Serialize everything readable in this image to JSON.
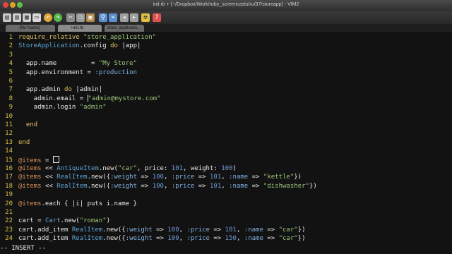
{
  "window": {
    "title": "init.rb + (~/Dropbox/Work/ruby_screencasts/ru/37/storeapp) - VIM2"
  },
  "toolbar": {
    "buttons": [
      "open-icon",
      "save-icon",
      "save-all-icon",
      "print-icon",
      "undo-icon",
      "redo-icon",
      "cut-icon",
      "copy-icon",
      "paste-icon",
      "find-icon",
      "find-next-icon",
      "back-icon",
      "forward-icon",
      "run-icon",
      "help-icon"
    ]
  },
  "tabs": [
    {
      "label": "-[No Name]",
      "active": false
    },
    {
      "label": "+init.rb",
      "active": true
    },
    {
      "label": "store_applicatio...",
      "active": false
    }
  ],
  "editor": {
    "lines": [
      {
        "num": "1",
        "tokens": [
          [
            "k",
            "require_relative"
          ],
          [
            "",
            ""
          ],
          [
            "s",
            " \"store_application\""
          ]
        ]
      },
      {
        "num": "2",
        "tokens": [
          [
            "c",
            "StoreApplication"
          ],
          [
            "",
            ".config "
          ],
          [
            "k",
            "do"
          ],
          [
            "",
            " |app|"
          ]
        ]
      },
      {
        "num": "3",
        "tokens": []
      },
      {
        "num": "4",
        "tokens": [
          [
            "",
            "  app.name         = "
          ],
          [
            "s",
            "\"My Store\""
          ]
        ]
      },
      {
        "num": "5",
        "tokens": [
          [
            "",
            "  app.environment = "
          ],
          [
            "t",
            ":production"
          ]
        ]
      },
      {
        "num": "6",
        "tokens": []
      },
      {
        "num": "7",
        "tokens": [
          [
            "",
            "  app.admin "
          ],
          [
            "k",
            "do"
          ],
          [
            "",
            " |admin|"
          ]
        ]
      },
      {
        "num": "8",
        "tokens": [
          [
            "",
            "    admin.email = "
          ],
          [
            "s",
            "\"admin@mystore.com\""
          ]
        ]
      },
      {
        "num": "9",
        "tokens": [
          [
            "",
            "    admin.login "
          ],
          [
            "s",
            "\"admin\""
          ]
        ]
      },
      {
        "num": "10",
        "tokens": []
      },
      {
        "num": "11",
        "tokens": [
          [
            "k",
            "  end"
          ]
        ]
      },
      {
        "num": "12",
        "tokens": []
      },
      {
        "num": "13",
        "tokens": [
          [
            "k",
            "end"
          ]
        ]
      },
      {
        "num": "14",
        "tokens": []
      },
      {
        "num": "15",
        "tokens": [
          [
            "i",
            "@items"
          ],
          [
            "",
            " = "
          ]
        ]
      },
      {
        "num": "16",
        "tokens": [
          [
            "i",
            "@items"
          ],
          [
            "",
            " << "
          ],
          [
            "c",
            "AntiqueItem"
          ],
          [
            "",
            ".new("
          ],
          [
            "s",
            "\"car\""
          ],
          [
            "",
            ", price: "
          ],
          [
            "n",
            "101"
          ],
          [
            "",
            ", weight: "
          ],
          [
            "n",
            "100"
          ],
          [
            "",
            ")"
          ]
        ]
      },
      {
        "num": "17",
        "tokens": [
          [
            "i",
            "@items"
          ],
          [
            "",
            " << "
          ],
          [
            "c",
            "RealItem"
          ],
          [
            "",
            ".new({"
          ],
          [
            "t",
            ":weight"
          ],
          [
            "",
            " => "
          ],
          [
            "n",
            "100"
          ],
          [
            "",
            ", "
          ],
          [
            "t",
            ":price"
          ],
          [
            "",
            " => "
          ],
          [
            "n",
            "101"
          ],
          [
            "",
            ", "
          ],
          [
            "t",
            ":name"
          ],
          [
            "",
            " => "
          ],
          [
            "s",
            "\"kettle\""
          ],
          [
            "",
            "})"
          ]
        ]
      },
      {
        "num": "18",
        "tokens": [
          [
            "i",
            "@items"
          ],
          [
            "",
            " << "
          ],
          [
            "c",
            "RealItem"
          ],
          [
            "",
            ".new({"
          ],
          [
            "t",
            ":weight"
          ],
          [
            "",
            " => "
          ],
          [
            "n",
            "100"
          ],
          [
            "",
            ", "
          ],
          [
            "t",
            ":price"
          ],
          [
            "",
            " => "
          ],
          [
            "n",
            "101"
          ],
          [
            "",
            ", "
          ],
          [
            "t",
            ":name"
          ],
          [
            "",
            " => "
          ],
          [
            "s",
            "\"dishwasher\""
          ],
          [
            "",
            "})"
          ]
        ]
      },
      {
        "num": "19",
        "tokens": []
      },
      {
        "num": "20",
        "tokens": [
          [
            "i",
            "@items"
          ],
          [
            "",
            ".each { |i| puts i.name }"
          ]
        ]
      },
      {
        "num": "21",
        "tokens": []
      },
      {
        "num": "22",
        "tokens": [
          [
            "",
            "cart = "
          ],
          [
            "c",
            "Cart"
          ],
          [
            "",
            ".new("
          ],
          [
            "s",
            "\"roman\""
          ],
          [
            "",
            ")"
          ]
        ]
      },
      {
        "num": "23",
        "tokens": [
          [
            "",
            "cart.add_item "
          ],
          [
            "c",
            "RealItem"
          ],
          [
            "",
            ".new({"
          ],
          [
            "t",
            ":weight"
          ],
          [
            "",
            " => "
          ],
          [
            "n",
            "100"
          ],
          [
            "",
            ", "
          ],
          [
            "t",
            ":price"
          ],
          [
            "",
            " => "
          ],
          [
            "n",
            "101"
          ],
          [
            "",
            ", "
          ],
          [
            "t",
            ":name"
          ],
          [
            "",
            " => "
          ],
          [
            "s",
            "\"car\""
          ],
          [
            "",
            "})"
          ]
        ]
      },
      {
        "num": "24",
        "tokens": [
          [
            "",
            "cart.add_item "
          ],
          [
            "c",
            "RealItem"
          ],
          [
            "",
            ".new({"
          ],
          [
            "t",
            ":weight"
          ],
          [
            "",
            " => "
          ],
          [
            "n",
            "100"
          ],
          [
            "",
            ", "
          ],
          [
            "t",
            ":price"
          ],
          [
            "",
            " => "
          ],
          [
            "n",
            "150"
          ],
          [
            "",
            ", "
          ],
          [
            "t",
            ":name"
          ],
          [
            "",
            " => "
          ],
          [
            "s",
            "\"car\""
          ],
          [
            "",
            "})"
          ]
        ]
      }
    ]
  },
  "status": {
    "mode": "-- INSERT --"
  },
  "colors": {
    "background": "#121212",
    "line_number": "#d6c24a",
    "keyword": "#e0c062",
    "string": "#9cc77a",
    "constant": "#5ea5d8",
    "number": "#6f9ad8",
    "ivar": "#d9905a",
    "symbol": "#7fb0e3"
  }
}
